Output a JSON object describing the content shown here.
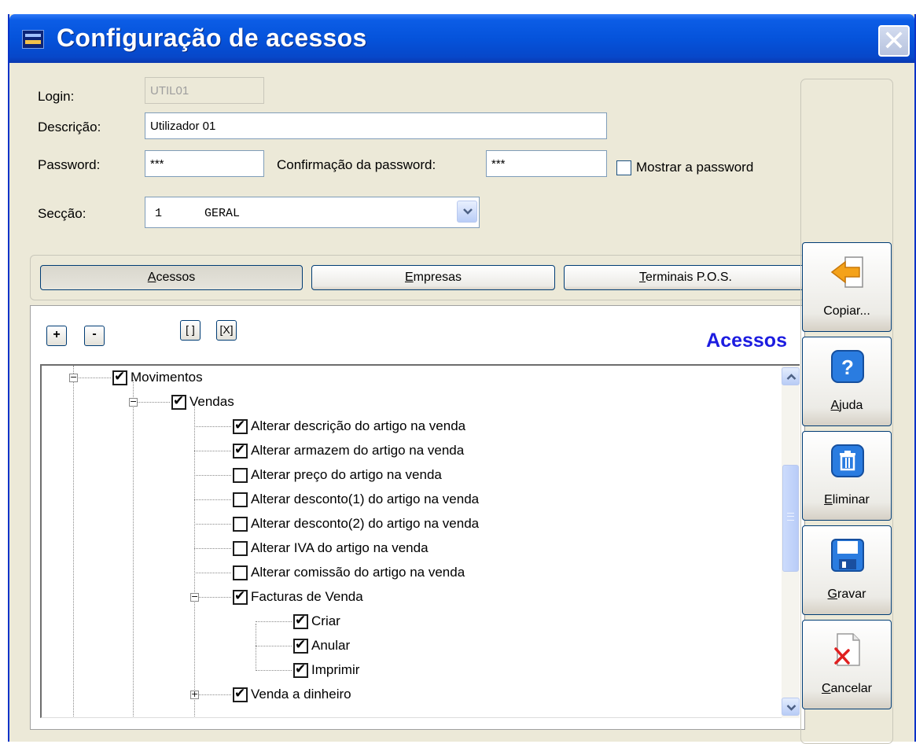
{
  "window": {
    "title": "Configuração de acessos"
  },
  "form": {
    "login_label": "Login:",
    "login_value": "UTIL01",
    "descricao_label": "Descrição:",
    "descricao_value": "Utilizador 01",
    "password_label": "Password:",
    "password_value": "***",
    "confirm_label": "Confirmação da password:",
    "confirm_value": "***",
    "show_password_label": "Mostrar a password",
    "show_password_checked": false,
    "seccao_label": "Secção:",
    "seccao_value": "1      GERAL"
  },
  "tabs": [
    {
      "label": "Acessos",
      "first": "A",
      "rest": "cessos",
      "active": true
    },
    {
      "label": "Empresas",
      "first": "E",
      "rest": "mpresas",
      "active": false
    },
    {
      "label": "Terminais P.O.S.",
      "first": "T",
      "rest": "erminais P.O.S.",
      "active": false
    }
  ],
  "panel": {
    "heading": "Acessos",
    "expand_label": "+",
    "collapse_label": "-",
    "uncheck_all_label": "[ ]",
    "check_all_label": "[X]"
  },
  "tree": [
    {
      "label": "Movimentos",
      "checked": true,
      "level": 1,
      "expander": "minus"
    },
    {
      "label": "Vendas",
      "checked": true,
      "level": 2,
      "expander": "minus"
    },
    {
      "label": "Alterar descrição do artigo na venda",
      "checked": true,
      "level": 3
    },
    {
      "label": "Alterar armazem do artigo na venda",
      "checked": true,
      "level": 3
    },
    {
      "label": "Alterar preço do artigo na venda",
      "checked": false,
      "level": 3
    },
    {
      "label": "Alterar desconto(1) do artigo na venda",
      "checked": false,
      "level": 3
    },
    {
      "label": "Alterar desconto(2) do artigo na venda",
      "checked": false,
      "level": 3
    },
    {
      "label": "Alterar IVA do artigo na venda",
      "checked": false,
      "level": 3
    },
    {
      "label": "Alterar comissão do artigo na venda",
      "checked": false,
      "level": 3
    },
    {
      "label": "Facturas de Venda",
      "checked": true,
      "level": 3,
      "expander": "minus"
    },
    {
      "label": "Criar",
      "checked": true,
      "level": 4
    },
    {
      "label": "Anular",
      "checked": true,
      "level": 4
    },
    {
      "label": "Imprimir",
      "checked": true,
      "level": 4
    },
    {
      "label": "Venda a dinheiro",
      "checked": true,
      "level": 3,
      "expander": "plus"
    }
  ],
  "actions": {
    "copiar": {
      "label": "Copiar...",
      "icon": "arrow-left-icon"
    },
    "ajuda": {
      "first": "A",
      "rest": "juda",
      "icon": "help-icon"
    },
    "eliminar": {
      "first": "E",
      "rest": "liminar",
      "icon": "trash-icon"
    },
    "gravar": {
      "first": "G",
      "rest": "ravar",
      "icon": "floppy-disk-icon"
    },
    "cancelar": {
      "first": "C",
      "rest": "ancelar",
      "icon": "cancel-document-icon"
    }
  },
  "colors": {
    "titlebar": "#0553db",
    "window_bg": "#ece9d8",
    "panel_heading": "#1c1ce0",
    "accent_orange": "#f4a21a"
  }
}
